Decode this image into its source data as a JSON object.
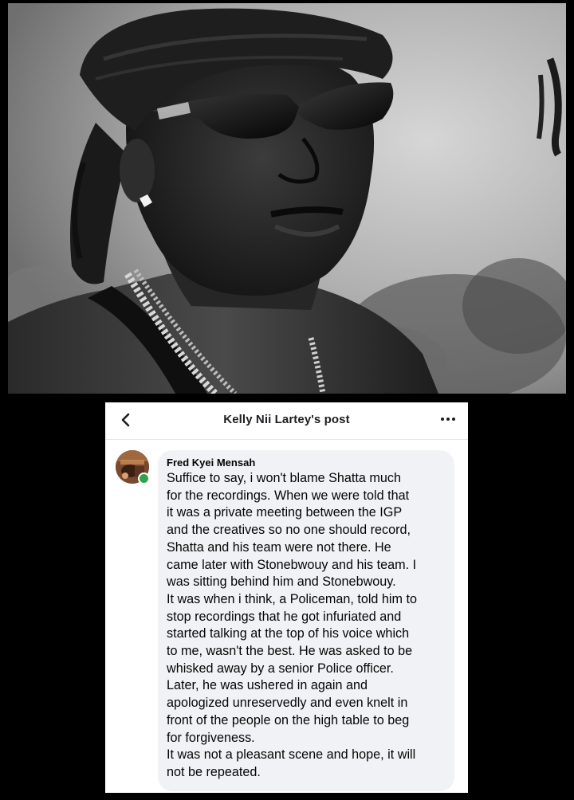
{
  "post_header": {
    "title": "Kelly Nii Lartey's post",
    "back_icon": "chevron-left-icon",
    "more_icon": "more-horizontal-icon"
  },
  "photo": {
    "description_icon": "portrait-photo"
  },
  "comment": {
    "author": "Fred Kyei Mensah",
    "online_status_color": "#31a24c",
    "lines": [
      "Suffice to say, i won't blame Shatta much",
      "for the recordings. When we were told that",
      "it was a private meeting between the IGP",
      "and the creatives so no one should record,",
      "Shatta and his team were not there. He",
      "came later with Stonebwouy and his team. I",
      "was sitting behind him and Stonebwouy.",
      "It was when i think, a Policeman, told him to",
      "stop recordings that he got infuriated and",
      "started talking at the top of his voice which",
      "to me, wasn't the best. He was asked to be",
      "whisked away by a senior Police officer.",
      "Later, he was ushered in again and",
      "apologized unreservedly and even knelt in",
      "front of the people on the high table to beg",
      "for forgiveness.",
      "It was not a pleasant scene and hope, it will",
      "not be repeated."
    ]
  },
  "colors": {
    "page_background": "#000000",
    "card_background": "#ffffff",
    "bubble_background": "#f0f2f5",
    "text": "#050505"
  }
}
